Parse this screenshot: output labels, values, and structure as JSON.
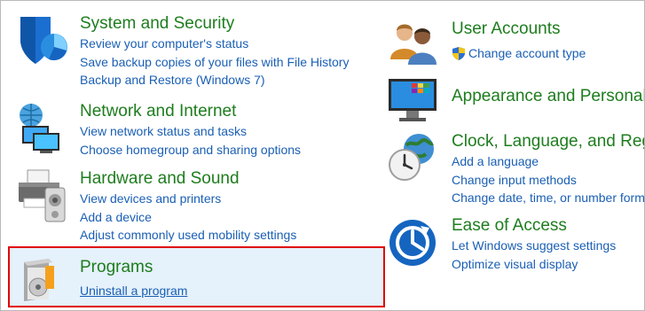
{
  "left": [
    {
      "title": "System and Security",
      "icon": "shield-icon",
      "links": [
        "Review your computer's status",
        "Save backup copies of your files with File History",
        "Backup and Restore (Windows 7)"
      ]
    },
    {
      "title": "Network and Internet",
      "icon": "network-icon",
      "links": [
        "View network status and tasks",
        "Choose homegroup and sharing options"
      ]
    },
    {
      "title": "Hardware and Sound",
      "icon": "printer-icon",
      "links": [
        "View devices and printers",
        "Add a device",
        "Adjust commonly used mobility settings"
      ]
    },
    {
      "title": "Programs",
      "icon": "programs-icon",
      "links": [
        "Uninstall a program"
      ]
    }
  ],
  "right": [
    {
      "title": "User Accounts",
      "icon": "users-icon",
      "links": [
        "Change account type"
      ]
    },
    {
      "title": "Appearance and Personaliz",
      "icon": "monitor-icon",
      "links": []
    },
    {
      "title": "Clock, Language, and Regi",
      "icon": "clock-globe-icon",
      "links": [
        "Add a language",
        "Change input methods",
        "Change date, time, or number form"
      ]
    },
    {
      "title": "Ease of Access",
      "icon": "ease-of-access-icon",
      "links": [
        "Let Windows suggest settings",
        "Optimize visual display"
      ]
    }
  ],
  "colors": {
    "title": "#1e7d1e",
    "link": "#1a5fb4",
    "highlight_bg": "#e5f1fb",
    "highlight_border": "#e00000"
  }
}
